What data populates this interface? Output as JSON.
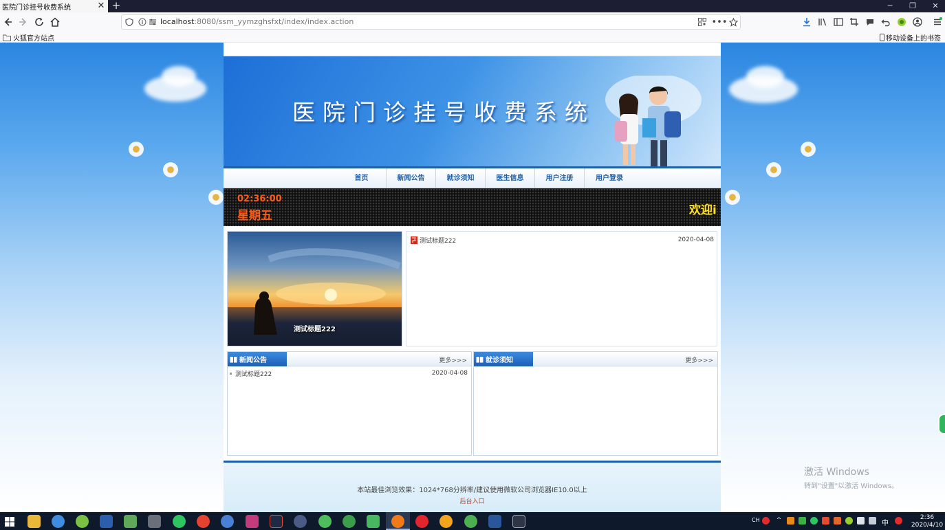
{
  "browser": {
    "tab_title": "医院门诊挂号收费系统",
    "url_host": "localhost",
    "url_rest": ":8080/ssm_yymzghsfxt/index/index.action",
    "bookmark_left": "火狐官方站点",
    "bookmark_right": "移动设备上的书签"
  },
  "site": {
    "banner_title": "医院门诊挂号收费系统",
    "menu": [
      "首页",
      "新闻公告",
      "就诊须知",
      "医生信息",
      "用户注册",
      "用户登录"
    ],
    "ticker": {
      "time": "02:36:00",
      "weekday": "星期五",
      "message": "欢迎i"
    },
    "slide_caption": "测试标题222",
    "top_news": [
      {
        "title": "测试标题222",
        "date": "2020-04-08"
      }
    ],
    "news_panel": {
      "title": "新闻公告",
      "more": "更多>>>",
      "items": [
        {
          "title": "测试标题222",
          "date": "2020-04-08"
        }
      ]
    },
    "guide_panel": {
      "title": "就诊须知",
      "more": "更多>>>",
      "items": []
    },
    "footer_text": "本站最佳浏览效果：1024*768分辨率/建议使用微软公司浏览器IE10.0以上",
    "footer_admin": "后台入口"
  },
  "watermark": {
    "line1": "激活 Windows",
    "line2": "转到\"设置\"以激活 Windows。"
  },
  "taskbar": {
    "time": "2:36",
    "date": "2020/4/10",
    "ime_lang": "中",
    "ime_mode": "CH"
  },
  "colors": {
    "accent": "#1f5fa8",
    "ticker_time": "#ff5a14",
    "ticker_msg": "#ffe020",
    "admin_link": "#c23b22"
  }
}
